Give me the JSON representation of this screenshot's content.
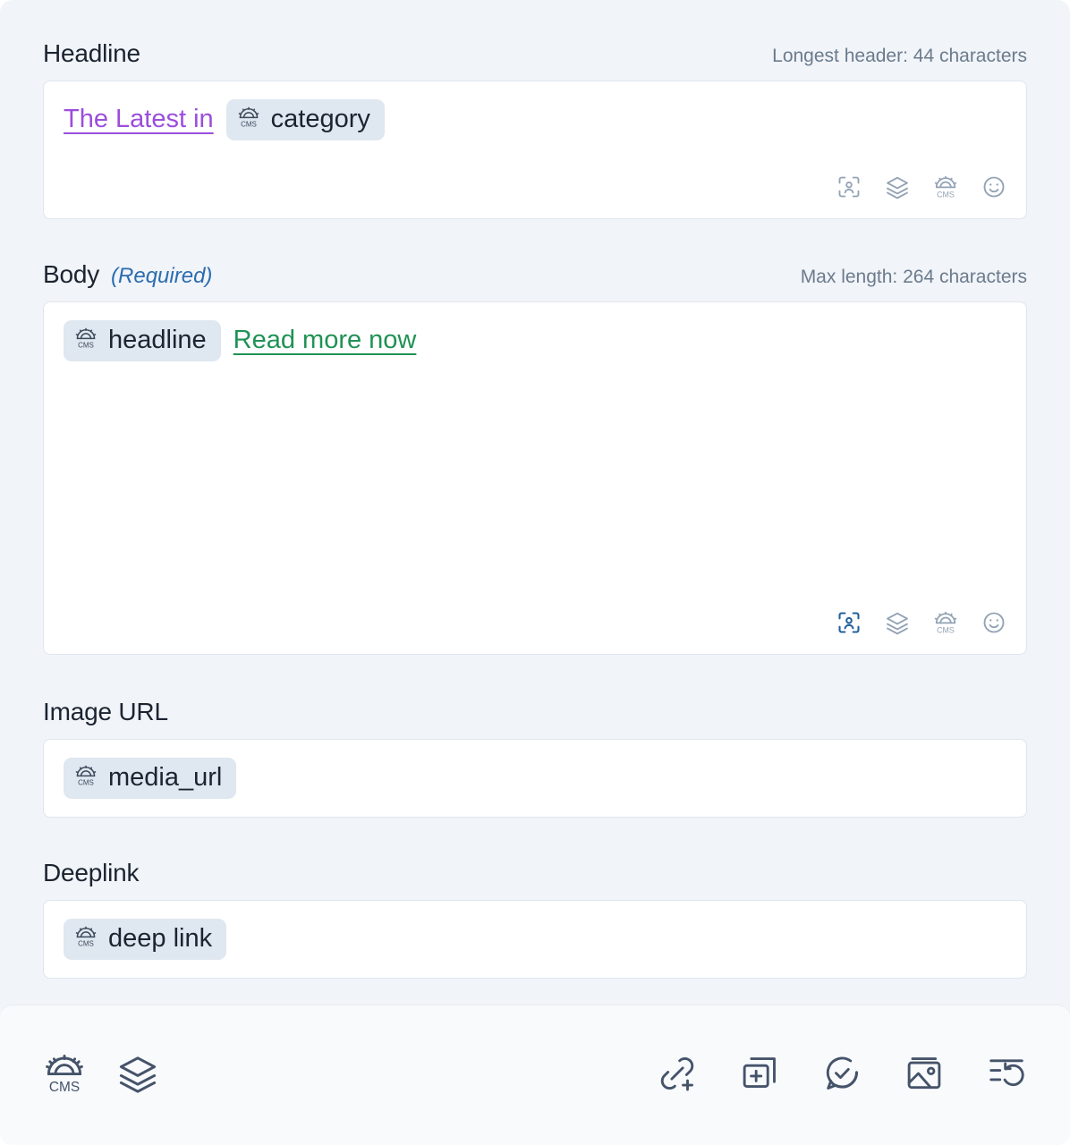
{
  "colors": {
    "page_bg": "#f1f4f8",
    "field_bg": "#ffffff",
    "field_border": "#dfe6ef",
    "chip_bg": "#dfe7f0",
    "label": "#1b2430",
    "hint": "#6b7b8d",
    "required": "#2b6cb0",
    "link_purple": "#9b4edb",
    "link_green": "#1f9254",
    "tool_icon": "#93a3b5",
    "tool_icon_active": "#23619c",
    "footer_bg": "#f8fafc",
    "footer_icon": "#45536a"
  },
  "fields": {
    "headline": {
      "label": "Headline",
      "hint": "Longest header: 44 characters",
      "content": {
        "prefix_text": "The Latest in",
        "token_label": "category",
        "token_icon": "cms-icon"
      },
      "tools": [
        {
          "name": "personalization-icon",
          "active": false
        },
        {
          "name": "layers-icon",
          "active": false
        },
        {
          "name": "cms-icon",
          "active": false
        },
        {
          "name": "emoji-icon",
          "active": false
        }
      ]
    },
    "body": {
      "label": "Body",
      "required_tag": "(Required)",
      "hint": "Max length: 264 characters",
      "content": {
        "token_label": "headline",
        "token_icon": "cms-icon",
        "suffix_text": "Read more now"
      },
      "tools": [
        {
          "name": "personalization-icon",
          "active": true
        },
        {
          "name": "layers-icon",
          "active": false
        },
        {
          "name": "cms-icon",
          "active": false
        },
        {
          "name": "emoji-icon",
          "active": false
        }
      ]
    },
    "image_url": {
      "label": "Image URL",
      "content": {
        "token_label": "media_url",
        "token_icon": "cms-icon"
      }
    },
    "deeplink": {
      "label": "Deeplink",
      "content": {
        "token_label": "deep link",
        "token_icon": "cms-icon"
      }
    }
  },
  "footer": {
    "left_tools": [
      {
        "name": "cms-icon"
      },
      {
        "name": "layers-icon"
      }
    ],
    "right_tools": [
      {
        "name": "add-link-icon"
      },
      {
        "name": "add-card-icon"
      },
      {
        "name": "spellcheck-chat-icon"
      },
      {
        "name": "image-icon"
      },
      {
        "name": "version-history-icon"
      }
    ]
  }
}
